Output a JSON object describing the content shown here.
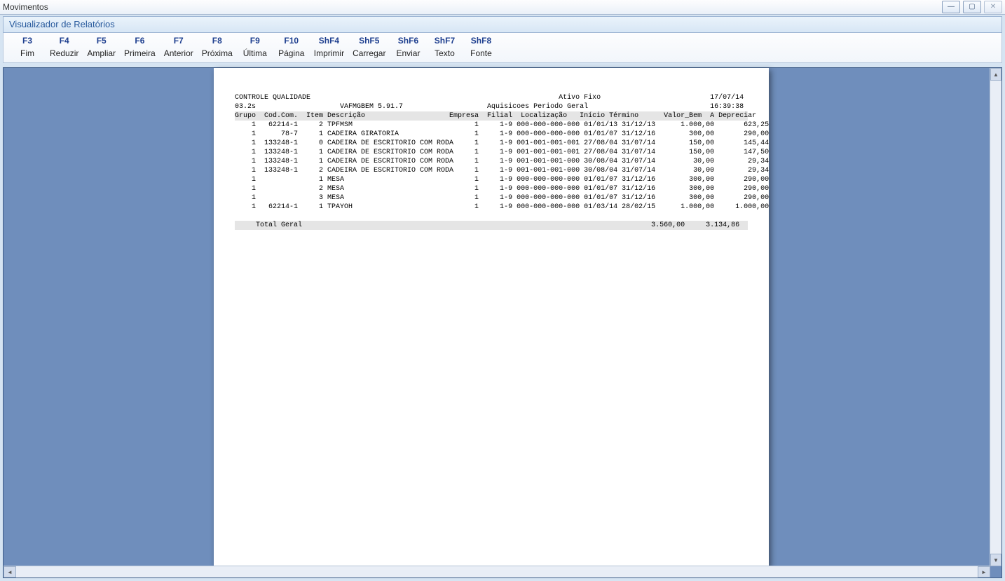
{
  "outer_window": {
    "title": "Movimentos"
  },
  "inner_window": {
    "title": "Visualizador de Relatórios"
  },
  "toolbar": [
    {
      "key": "F3",
      "label": "Fim"
    },
    {
      "key": "F4",
      "label": "Reduzir"
    },
    {
      "key": "F5",
      "label": "Ampliar"
    },
    {
      "key": "F6",
      "label": "Primeira"
    },
    {
      "key": "F7",
      "label": "Anterior"
    },
    {
      "key": "F8",
      "label": "Próxima"
    },
    {
      "key": "F9",
      "label": "Última"
    },
    {
      "key": "F10",
      "label": "Página"
    },
    {
      "key": "ShF4",
      "label": "Imprimir"
    },
    {
      "key": "ShF5",
      "label": "Carregar"
    },
    {
      "key": "ShF6",
      "label": "Enviar"
    },
    {
      "key": "ShF7",
      "label": "Texto"
    },
    {
      "key": "ShF8",
      "label": "Fonte"
    }
  ],
  "report": {
    "company": "CONTROLE QUALIDADE",
    "module": "Ativo Fixo",
    "date": "17/07/14",
    "version_left": "03.2s",
    "program": "VAFMGBEM 5.91.7",
    "subtitle": "Aquisicoes Periodo Geral",
    "time": "16:39:38",
    "columns": {
      "grupo": "Grupo",
      "codcom": "Cod.Com.",
      "item": "Item",
      "descricao": "Descrição",
      "empresa": "Empresa",
      "filial": "Filial",
      "localizacao": "Localização",
      "inicio": "Início",
      "termino": "Término",
      "valor_bem": "Valor_Bem",
      "a_depreciar": "A Depreciar"
    },
    "rows": [
      {
        "grupo": "1",
        "codcom": "62214-1",
        "item": "2",
        "desc": "TPFMSM",
        "emp": "1",
        "fil": "1-9",
        "loc": "000-000-000-000",
        "ini": "01/01/13",
        "ter": "31/12/13",
        "vb": "1.000,00",
        "dep": "623,25"
      },
      {
        "grupo": "1",
        "codcom": "78-7",
        "item": "1",
        "desc": "CADEIRA GIRATORIA",
        "emp": "1",
        "fil": "1-9",
        "loc": "000-000-000-000",
        "ini": "01/01/07",
        "ter": "31/12/16",
        "vb": "300,00",
        "dep": "290,00"
      },
      {
        "grupo": "1",
        "codcom": "133248-1",
        "item": "0",
        "desc": "CADEIRA DE ESCRITORIO COM RODA",
        "emp": "1",
        "fil": "1-9",
        "loc": "001-001-001-001",
        "ini": "27/08/04",
        "ter": "31/07/14",
        "vb": "150,00",
        "dep": "145,44"
      },
      {
        "grupo": "1",
        "codcom": "133248-1",
        "item": "1",
        "desc": "CADEIRA DE ESCRITORIO COM RODA",
        "emp": "1",
        "fil": "1-9",
        "loc": "001-001-001-001",
        "ini": "27/08/04",
        "ter": "31/07/14",
        "vb": "150,00",
        "dep": "147,50"
      },
      {
        "grupo": "1",
        "codcom": "133248-1",
        "item": "1",
        "desc": "CADEIRA DE ESCRITORIO COM RODA",
        "emp": "1",
        "fil": "1-9",
        "loc": "001-001-001-000",
        "ini": "30/08/04",
        "ter": "31/07/14",
        "vb": "30,00",
        "dep": "29,34"
      },
      {
        "grupo": "1",
        "codcom": "133248-1",
        "item": "2",
        "desc": "CADEIRA DE ESCRITORIO COM RODA",
        "emp": "1",
        "fil": "1-9",
        "loc": "001-001-001-000",
        "ini": "30/08/04",
        "ter": "31/07/14",
        "vb": "30,00",
        "dep": "29,34"
      },
      {
        "grupo": "1",
        "codcom": "",
        "item": "1",
        "desc": "MESA",
        "emp": "1",
        "fil": "1-9",
        "loc": "000-000-000-000",
        "ini": "01/01/07",
        "ter": "31/12/16",
        "vb": "300,00",
        "dep": "290,00"
      },
      {
        "grupo": "1",
        "codcom": "",
        "item": "2",
        "desc": "MESA",
        "emp": "1",
        "fil": "1-9",
        "loc": "000-000-000-000",
        "ini": "01/01/07",
        "ter": "31/12/16",
        "vb": "300,00",
        "dep": "290,00"
      },
      {
        "grupo": "1",
        "codcom": "",
        "item": "3",
        "desc": "MESA",
        "emp": "1",
        "fil": "1-9",
        "loc": "000-000-000-000",
        "ini": "01/01/07",
        "ter": "31/12/16",
        "vb": "300,00",
        "dep": "290,00"
      },
      {
        "grupo": "1",
        "codcom": "62214-1",
        "item": "1",
        "desc": "TPAYOH",
        "emp": "1",
        "fil": "1-9",
        "loc": "000-000-000-000",
        "ini": "01/03/14",
        "ter": "28/02/15",
        "vb": "1.000,00",
        "dep": "1.000,00"
      }
    ],
    "total_label": "Total Geral",
    "total_vb": "3.560,00",
    "total_dep": "3.134,86"
  }
}
